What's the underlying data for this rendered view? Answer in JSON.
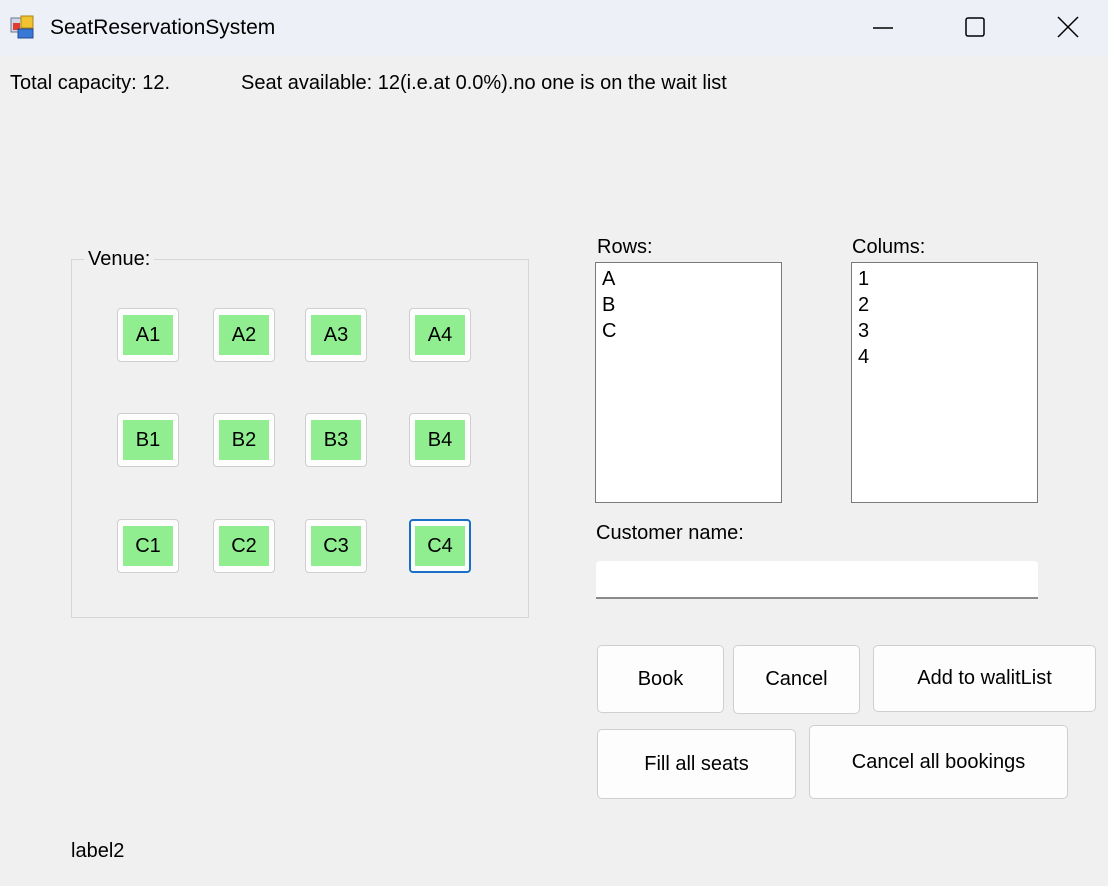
{
  "window": {
    "title": "SeatReservationSystem",
    "icon": "app-icon",
    "controls": [
      "minimize-icon",
      "maximize-icon",
      "close-icon"
    ]
  },
  "info": {
    "capacity": "Total capacity: 12.",
    "available": "Seat available: 12(i.e.at 0.0%).no one is on the wait list"
  },
  "venue": {
    "label": "Venue:",
    "seat_color": "#90ee90",
    "seats": [
      [
        "A1",
        "A2",
        "A3",
        "A4"
      ],
      [
        "B1",
        "B2",
        "B3",
        "B4"
      ],
      [
        "C1",
        "C2",
        "C3",
        "C4"
      ]
    ]
  },
  "rows": {
    "label": "Rows:",
    "items": [
      "A",
      "B",
      "C"
    ]
  },
  "columns": {
    "label": "Colums:",
    "items": [
      "1",
      "2",
      "3",
      "4"
    ]
  },
  "customer": {
    "label": "Customer name:",
    "value": ""
  },
  "buttons": {
    "book": "Book",
    "cancel": "Cancel",
    "add_waitlist": "Add to walitList",
    "fill_all": "Fill all seats",
    "cancel_all": "Cancel all bookings"
  },
  "status_label": "label2"
}
